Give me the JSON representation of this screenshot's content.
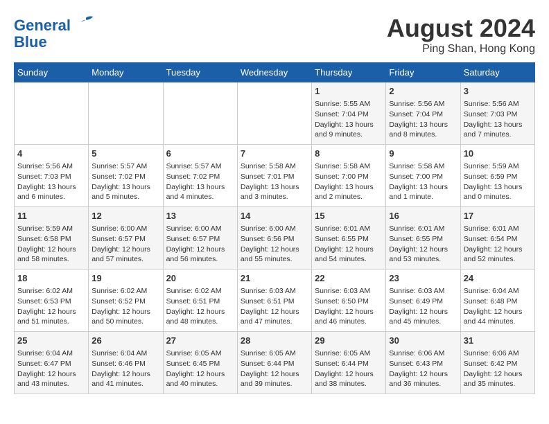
{
  "header": {
    "logo_line1": "General",
    "logo_line2": "Blue",
    "month": "August 2024",
    "location": "Ping Shan, Hong Kong"
  },
  "weekdays": [
    "Sunday",
    "Monday",
    "Tuesday",
    "Wednesday",
    "Thursday",
    "Friday",
    "Saturday"
  ],
  "weeks": [
    [
      {
        "day": "",
        "info": ""
      },
      {
        "day": "",
        "info": ""
      },
      {
        "day": "",
        "info": ""
      },
      {
        "day": "",
        "info": ""
      },
      {
        "day": "1",
        "info": "Sunrise: 5:55 AM\nSunset: 7:04 PM\nDaylight: 13 hours\nand 9 minutes."
      },
      {
        "day": "2",
        "info": "Sunrise: 5:56 AM\nSunset: 7:04 PM\nDaylight: 13 hours\nand 8 minutes."
      },
      {
        "day": "3",
        "info": "Sunrise: 5:56 AM\nSunset: 7:03 PM\nDaylight: 13 hours\nand 7 minutes."
      }
    ],
    [
      {
        "day": "4",
        "info": "Sunrise: 5:56 AM\nSunset: 7:03 PM\nDaylight: 13 hours\nand 6 minutes."
      },
      {
        "day": "5",
        "info": "Sunrise: 5:57 AM\nSunset: 7:02 PM\nDaylight: 13 hours\nand 5 minutes."
      },
      {
        "day": "6",
        "info": "Sunrise: 5:57 AM\nSunset: 7:02 PM\nDaylight: 13 hours\nand 4 minutes."
      },
      {
        "day": "7",
        "info": "Sunrise: 5:58 AM\nSunset: 7:01 PM\nDaylight: 13 hours\nand 3 minutes."
      },
      {
        "day": "8",
        "info": "Sunrise: 5:58 AM\nSunset: 7:00 PM\nDaylight: 13 hours\nand 2 minutes."
      },
      {
        "day": "9",
        "info": "Sunrise: 5:58 AM\nSunset: 7:00 PM\nDaylight: 13 hours\nand 1 minute."
      },
      {
        "day": "10",
        "info": "Sunrise: 5:59 AM\nSunset: 6:59 PM\nDaylight: 13 hours\nand 0 minutes."
      }
    ],
    [
      {
        "day": "11",
        "info": "Sunrise: 5:59 AM\nSunset: 6:58 PM\nDaylight: 12 hours\nand 58 minutes."
      },
      {
        "day": "12",
        "info": "Sunrise: 6:00 AM\nSunset: 6:57 PM\nDaylight: 12 hours\nand 57 minutes."
      },
      {
        "day": "13",
        "info": "Sunrise: 6:00 AM\nSunset: 6:57 PM\nDaylight: 12 hours\nand 56 minutes."
      },
      {
        "day": "14",
        "info": "Sunrise: 6:00 AM\nSunset: 6:56 PM\nDaylight: 12 hours\nand 55 minutes."
      },
      {
        "day": "15",
        "info": "Sunrise: 6:01 AM\nSunset: 6:55 PM\nDaylight: 12 hours\nand 54 minutes."
      },
      {
        "day": "16",
        "info": "Sunrise: 6:01 AM\nSunset: 6:55 PM\nDaylight: 12 hours\nand 53 minutes."
      },
      {
        "day": "17",
        "info": "Sunrise: 6:01 AM\nSunset: 6:54 PM\nDaylight: 12 hours\nand 52 minutes."
      }
    ],
    [
      {
        "day": "18",
        "info": "Sunrise: 6:02 AM\nSunset: 6:53 PM\nDaylight: 12 hours\nand 51 minutes."
      },
      {
        "day": "19",
        "info": "Sunrise: 6:02 AM\nSunset: 6:52 PM\nDaylight: 12 hours\nand 50 minutes."
      },
      {
        "day": "20",
        "info": "Sunrise: 6:02 AM\nSunset: 6:51 PM\nDaylight: 12 hours\nand 48 minutes."
      },
      {
        "day": "21",
        "info": "Sunrise: 6:03 AM\nSunset: 6:51 PM\nDaylight: 12 hours\nand 47 minutes."
      },
      {
        "day": "22",
        "info": "Sunrise: 6:03 AM\nSunset: 6:50 PM\nDaylight: 12 hours\nand 46 minutes."
      },
      {
        "day": "23",
        "info": "Sunrise: 6:03 AM\nSunset: 6:49 PM\nDaylight: 12 hours\nand 45 minutes."
      },
      {
        "day": "24",
        "info": "Sunrise: 6:04 AM\nSunset: 6:48 PM\nDaylight: 12 hours\nand 44 minutes."
      }
    ],
    [
      {
        "day": "25",
        "info": "Sunrise: 6:04 AM\nSunset: 6:47 PM\nDaylight: 12 hours\nand 43 minutes."
      },
      {
        "day": "26",
        "info": "Sunrise: 6:04 AM\nSunset: 6:46 PM\nDaylight: 12 hours\nand 41 minutes."
      },
      {
        "day": "27",
        "info": "Sunrise: 6:05 AM\nSunset: 6:45 PM\nDaylight: 12 hours\nand 40 minutes."
      },
      {
        "day": "28",
        "info": "Sunrise: 6:05 AM\nSunset: 6:44 PM\nDaylight: 12 hours\nand 39 minutes."
      },
      {
        "day": "29",
        "info": "Sunrise: 6:05 AM\nSunset: 6:44 PM\nDaylight: 12 hours\nand 38 minutes."
      },
      {
        "day": "30",
        "info": "Sunrise: 6:06 AM\nSunset: 6:43 PM\nDaylight: 12 hours\nand 36 minutes."
      },
      {
        "day": "31",
        "info": "Sunrise: 6:06 AM\nSunset: 6:42 PM\nDaylight: 12 hours\nand 35 minutes."
      }
    ]
  ]
}
